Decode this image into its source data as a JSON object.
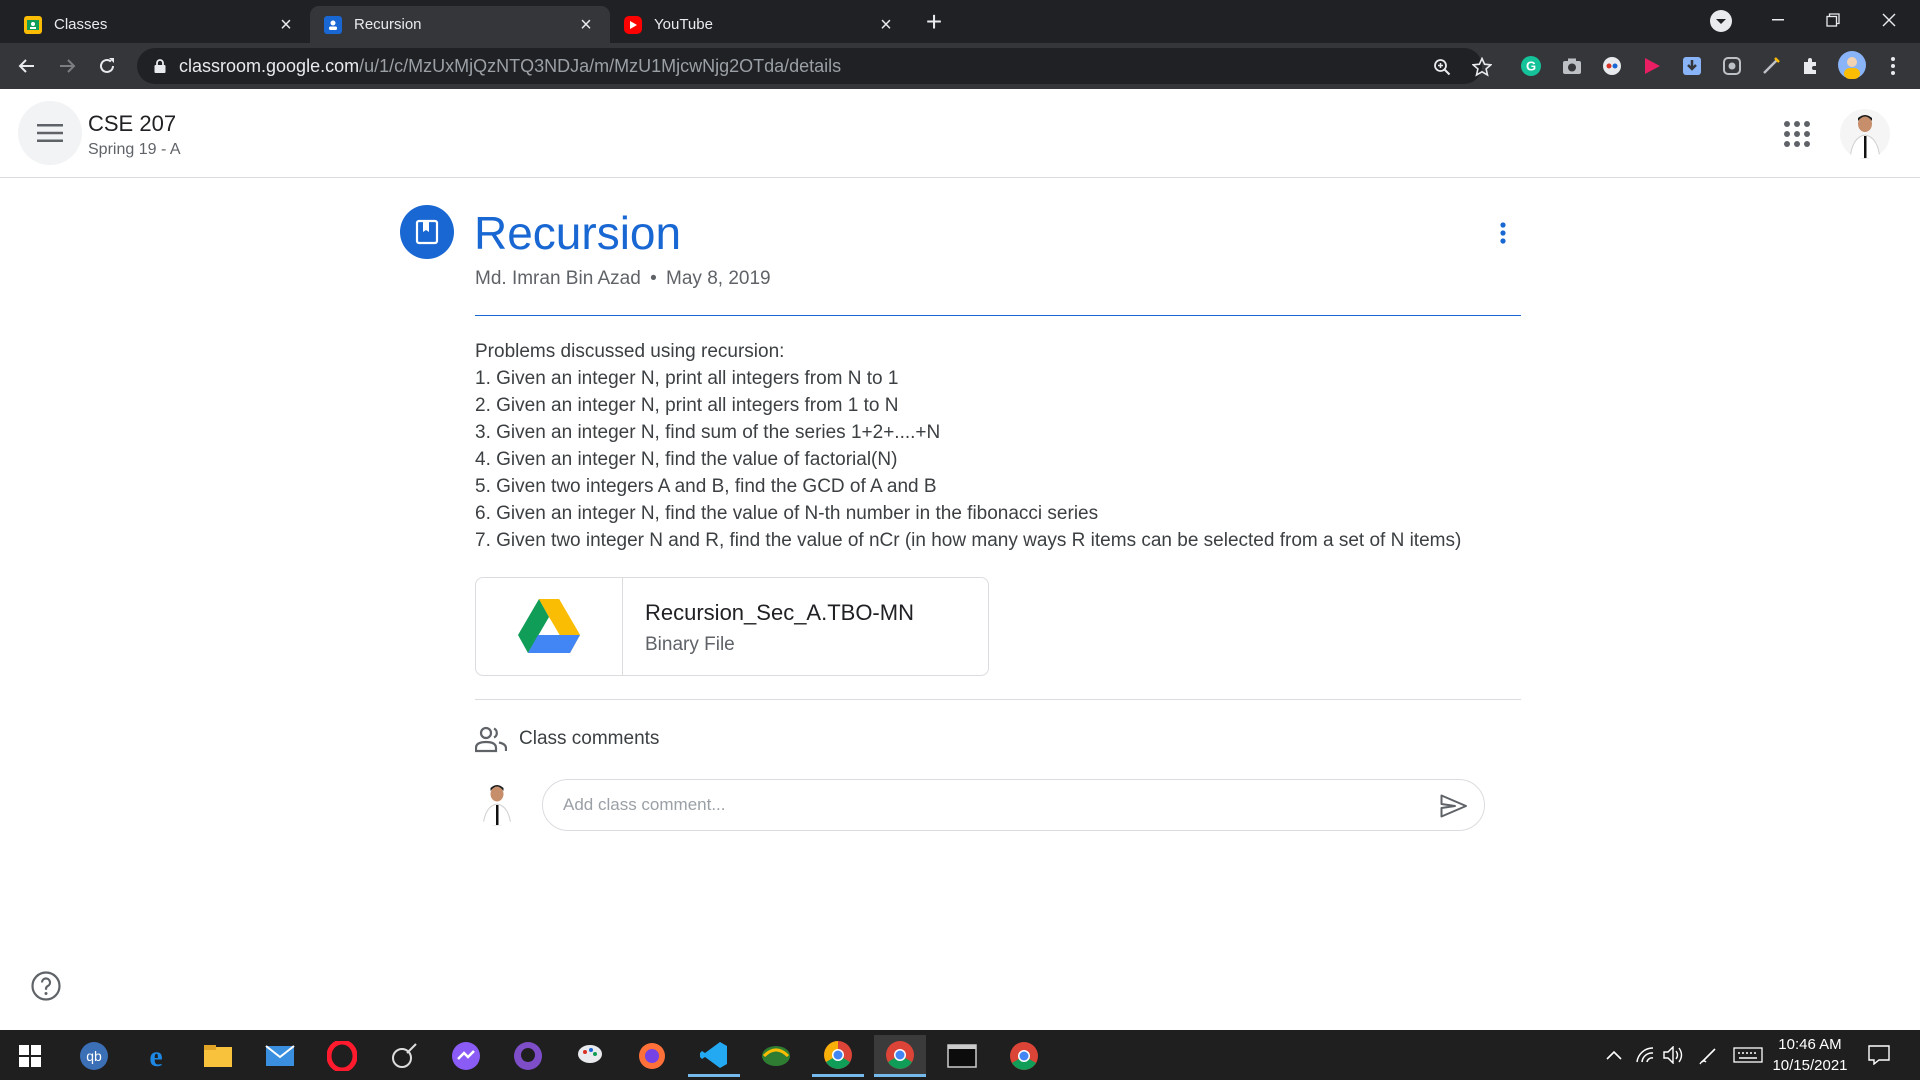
{
  "browser": {
    "tabs": [
      {
        "title": "Classes",
        "active": false,
        "favicon_color": "#fbbc04"
      },
      {
        "title": "Recursion",
        "active": true,
        "favicon_color": "#1967d2"
      },
      {
        "title": "YouTube",
        "active": false,
        "favicon_color": "#ff0000"
      }
    ],
    "url_host": "classroom.google.com",
    "url_path": "/u/1/c/MzUxMjQzNTQ3NDJa/m/MzU1MjcwNjg2OTda/details"
  },
  "header": {
    "class_name": "CSE 207",
    "class_section": "Spring 19 - A"
  },
  "material": {
    "title": "Recursion",
    "author": "Md. Imran Bin Azad",
    "separator": "•",
    "date": "May 8, 2019",
    "description_lines": [
      "Problems discussed using recursion:",
      "1. Given an integer N, print all integers from N to 1",
      "2. Given an integer N, print all integers from 1 to N",
      "3. Given an integer N, find sum of the series 1+2+....+N",
      "4. Given an integer N, find the value of factorial(N)",
      "5. Given two integers A and B, find the GCD of A and B",
      "6. Given an integer N, find the value of N-th number in the fibonacci series",
      "7. Given two integer N and R, find the value of nCr (in how many ways R items can be selected from a set of N items)"
    ],
    "attachment": {
      "name": "Recursion_Sec_A.TBO-MN",
      "type": "Binary File",
      "icon": "google-drive-icon"
    }
  },
  "comments": {
    "label": "Class comments",
    "placeholder": "Add class comment..."
  },
  "taskbar": {
    "time": "10:46 AM",
    "date": "10/15/2021"
  },
  "colors": {
    "accent": "#1967d2",
    "chrome_dark": "#202124",
    "chrome_toolbar": "#35363a",
    "taskbar": "#1f1f1f"
  }
}
